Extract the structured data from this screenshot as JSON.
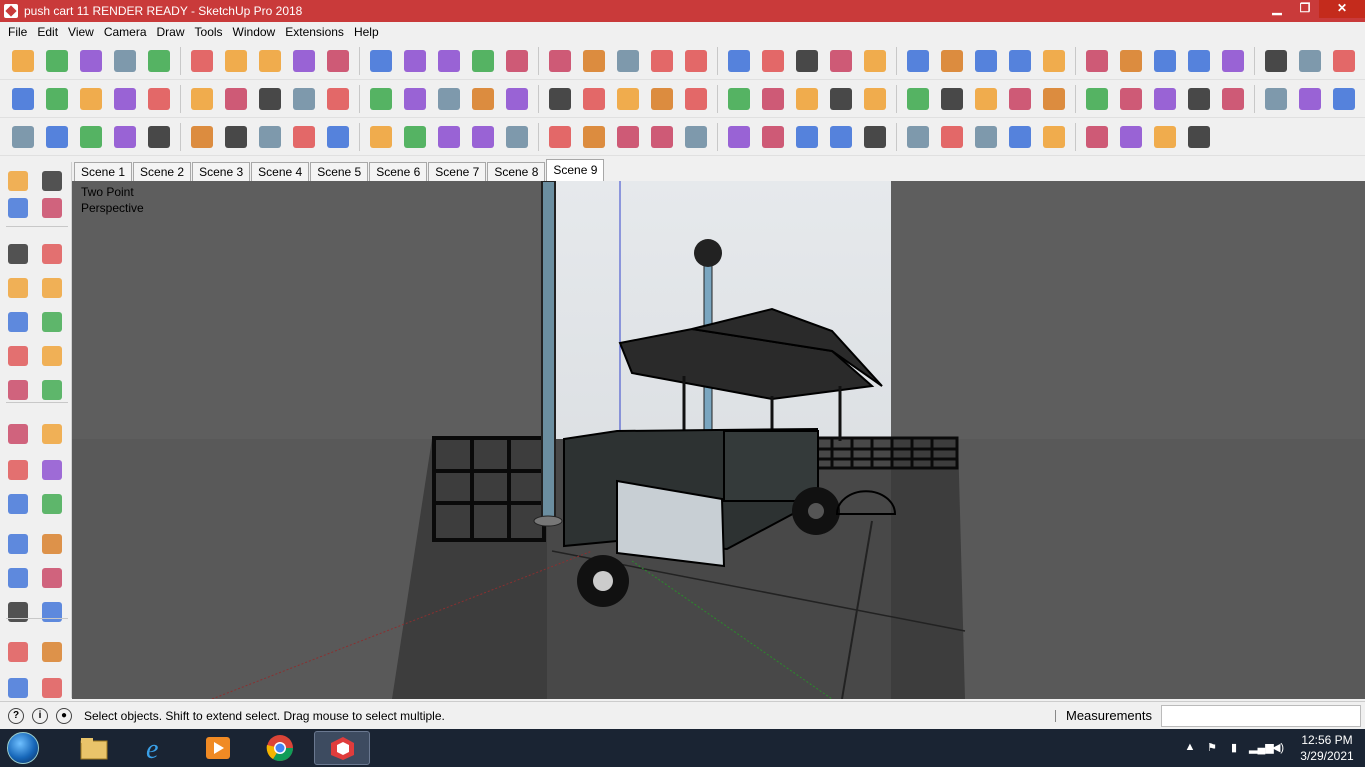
{
  "window": {
    "title": "push cart 11 RENDER READY - SketchUp Pro 2018",
    "minimize": "▁",
    "maximize": "❐",
    "close": "✕"
  },
  "menu": [
    "File",
    "Edit",
    "View",
    "Camera",
    "Draw",
    "Tools",
    "Window",
    "Extensions",
    "Help"
  ],
  "toolbars": {
    "row1": [
      "select-icon",
      "eraser-icon",
      "pencil-icon",
      "dropdown-icon",
      "arc-icon",
      "dropdown-icon",
      "rectangle-icon",
      "dropdown-icon",
      "push-pull-icon",
      "follow-me-icon",
      "move-icon",
      "rotate-icon",
      "scale-icon",
      "tape-measure-icon",
      "text-icon",
      "paint-bucket-icon",
      "orbit-icon",
      "pan-icon",
      "zoom-icon",
      "zoom-extents-icon",
      "3d-warehouse-icon",
      "extension-warehouse-icon",
      "layout-icon",
      "ruby-icon",
      "component-icon",
      "section-icon",
      "home-icon",
      "house-icon",
      "house-outline-icon",
      "roof-icon",
      "shadow-icon",
      "red-view-icon",
      "blue-view-icon",
      "red-view-icon",
      "green-view-icon",
      "orange-view-icon",
      "orange-view-icon",
      "magenta-view-icon"
    ],
    "row2": [
      "style-icon",
      "teapot-icon",
      "hand-icon",
      "cloud-icon",
      "dimension-icon",
      "protractor-icon",
      "box-icon",
      "box-icon",
      "box-icon",
      "lock-icon",
      "funnel-icon",
      "circle-icon",
      "triangle-icon",
      "umbrella-icon",
      "sun-icon",
      "dome-icon",
      "sphere-icon",
      "sandbox-icon",
      "box-icon",
      "box-icon",
      "grass-icon",
      "eraser-icon",
      "outer-shell-icon",
      "union-icon",
      "intersect-icon",
      "wireframe-icon",
      "hidden-line-icon",
      "shaded-icon",
      "textured-icon",
      "monochrome-icon",
      "xray-icon",
      "orbit-icon",
      "pan-icon",
      "zoom-icon",
      "zoom-window-icon",
      "zoom-extents-icon",
      "previous-icon",
      "walk-icon",
      "more-icon"
    ],
    "row3": [
      "solid-tools-icon",
      "grid-icon",
      "stamp-icon",
      "drape-icon",
      "smoove-icon",
      "terrain-icon",
      "flip-icon",
      "tree-icon",
      "trees-icon",
      "trees-icon",
      "globe-icon",
      "fredo-icon",
      "photo-icon",
      "blob-icon",
      "shapes-icon",
      "polygon-icon",
      "brick-icon",
      "flip-along-icon",
      "blue-cube-icon",
      "blue-plane-icon",
      "arrows-icon",
      "arrows-icon",
      "arrow-diag-icon",
      "hourglass-icon",
      "undo-icon",
      "redo-icon",
      "paint-icon",
      "orange-cube-icon",
      "cube-icon",
      "cube-icon",
      "target-icon",
      "axis-icon",
      "protractor-icon",
      "line-icon"
    ]
  },
  "scene_tabs": [
    "Scene 1",
    "Scene 2",
    "Scene 3",
    "Scene 4",
    "Scene 5",
    "Scene 6",
    "Scene 7",
    "Scene 8",
    "Scene 9"
  ],
  "active_scene": "Scene 9",
  "viewport": {
    "camera_label": "Two Point\nPerspective"
  },
  "left_tools": [
    "select-icon",
    "component-icon",
    "paint-bucket-icon",
    "eraser-icon",
    "pencil-icon",
    "freehand-icon",
    "rectangle-icon",
    "rotated-rectangle-icon",
    "circle-icon",
    "polygon-icon",
    "arc-icon",
    "two-point-arc-icon",
    "three-point-arc-icon",
    "pie-icon",
    "move-icon",
    "push-pull-icon",
    "rotate-icon",
    "follow-me-icon",
    "scale-icon",
    "offset-icon",
    "tape-measure-icon",
    "dimension-icon",
    "protractor-icon",
    "text-icon",
    "axes-icon",
    "3d-text-icon",
    "orbit-icon",
    "pan-icon",
    "zoom-icon",
    "zoom-window-icon"
  ],
  "status": {
    "icons": [
      "?",
      "i",
      "person"
    ],
    "message": "Select objects. Shift to extend select. Drag mouse to select multiple.",
    "measurements_label": "Measurements",
    "measurements_value": ""
  },
  "taskbar": {
    "apps": [
      "file-explorer-icon",
      "internet-explorer-icon",
      "media-player-icon",
      "chrome-icon",
      "sketchup-icon"
    ],
    "time": "12:56 PM",
    "date": "3/29/2021"
  }
}
